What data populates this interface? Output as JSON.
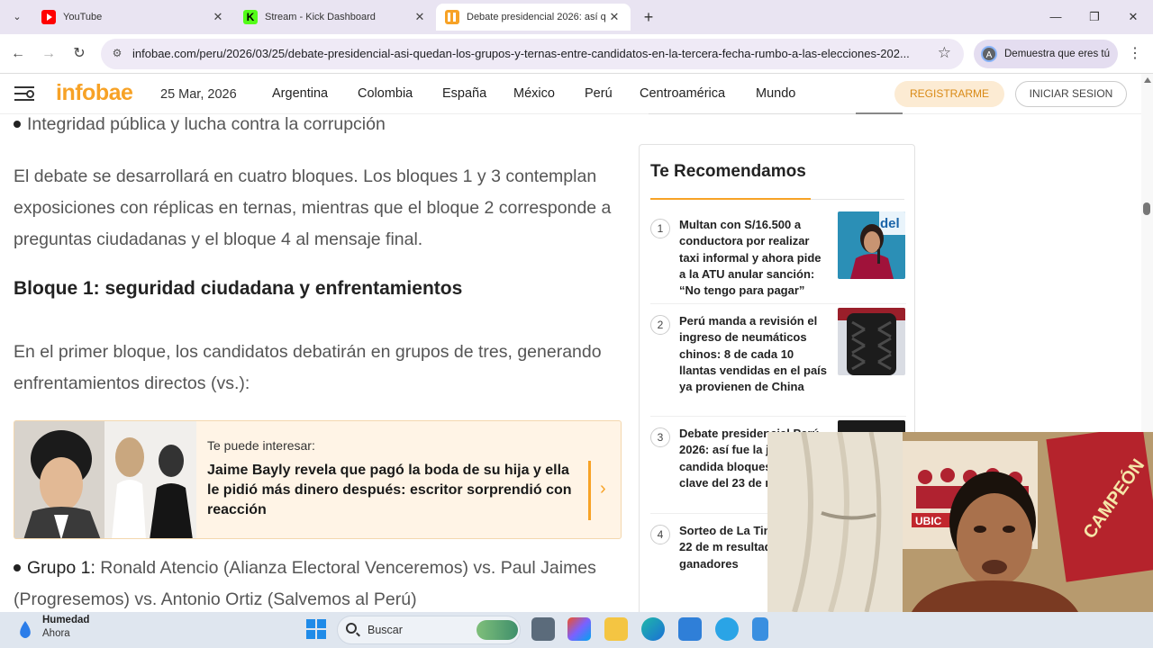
{
  "browser": {
    "tabs": [
      {
        "title": "YouTube",
        "icon": "youtube-favicon",
        "active": false
      },
      {
        "title": "Stream - Kick Dashboard",
        "icon": "kick-favicon",
        "active": false
      },
      {
        "title": "Debate presidencial 2026: así q",
        "icon": "infobae-favicon",
        "active": true
      }
    ],
    "kick_glyph": "K",
    "url": "infobae.com/peru/2026/03/25/debate-presidencial-asi-quedan-los-grupos-y-ternas-entre-candidatos-en-la-tercera-fecha-rumbo-a-las-elecciones-202...",
    "profile_label": "Demuestra que eres tú",
    "profile_initial": "A"
  },
  "site": {
    "logo": "infobae",
    "date": "25 Mar, 2026",
    "nav": [
      "Argentina",
      "Colombia",
      "España",
      "México",
      "Perú",
      "Centroamérica",
      "Mundo"
    ],
    "register": "REGISTRARME",
    "login": "INICIAR SESION",
    "brand_color": "#f7a226"
  },
  "article": {
    "bullet_prev": "Integridad pública y lucha contra la corrupción",
    "para1": "El debate se desarrollará en cuatro bloques. Los bloques 1 y 3 contemplan exposiciones con réplicas en ternas, mientras que el bloque 2 corresponde a preguntas ciudadanas y el bloque 4 al mensaje final.",
    "heading": "Bloque 1: seguridad ciudadana y enfrentamientos",
    "para2": "En el primer bloque, los candidatos debatirán en grupos de tres, generando enfrentamientos directos (vs.):",
    "related": {
      "kicker": "Te puede interesar:",
      "title": "Jaime Bayly revela que pagó la boda de su hija y ella le pidió más dinero después: escritor sorprendió con reacción"
    },
    "group1_label": "Grupo 1:",
    "group1_text": " Ronald Atencio (Alianza Electoral Venceremos) vs. Paul Jaimes (Progresemos) vs. Antonio Ortiz (Salvemos al Perú)"
  },
  "sidebar": {
    "title": "Te Recomendamos",
    "items": [
      {
        "num": "1",
        "text": "Multan con S/16.500 a conductora por realizar taxi informal y ahora pide a la ATU anular sanción: “No tengo para pagar”"
      },
      {
        "num": "2",
        "text": "Perú manda a revisión el ingreso de neumáticos chinos: 8 de cada 10 llantas vendidas en el país ya provienen de China"
      },
      {
        "num": "3",
        "text": "Debate presidencial Perú 2026: así fue la jornada, candida bloques y propu clave del 23 de m"
      },
      {
        "num": "4",
        "text": "Sorteo de La Tin domingo 22 de m resultados y núm ganadores"
      }
    ],
    "thumb1_text": "del"
  },
  "webcam": {
    "poster_text": "CAMPEÓN",
    "banner_text": "UBIC"
  },
  "taskbar": {
    "weather_title": "Humedad",
    "weather_sub": "Ahora",
    "search": "Buscar"
  }
}
